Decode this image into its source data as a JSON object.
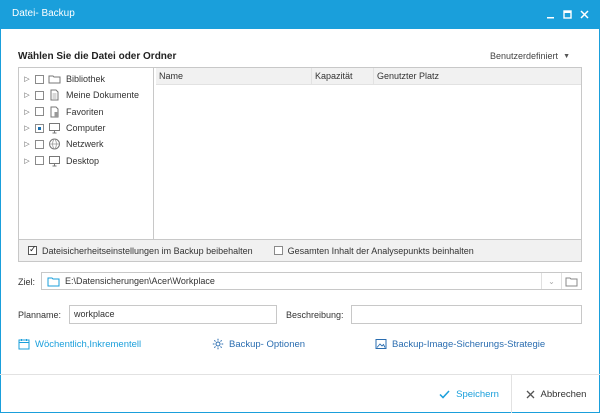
{
  "window": {
    "title": "Datei- Backup"
  },
  "section_title": "Wählen Sie die Datei oder Ordner",
  "filter_dropdown": {
    "label": "Benutzerdefiniert"
  },
  "tree": [
    {
      "label": "Bibliothek",
      "icon": "folder-icon",
      "state": "unchecked"
    },
    {
      "label": "Meine Dokumente",
      "icon": "document-icon",
      "state": "unchecked"
    },
    {
      "label": "Favoriten",
      "icon": "favorites-icon",
      "state": "unchecked"
    },
    {
      "label": "Computer",
      "icon": "computer-icon",
      "state": "partial"
    },
    {
      "label": "Netzwerk",
      "icon": "network-icon",
      "state": "unchecked"
    },
    {
      "label": "Desktop",
      "icon": "desktop-icon",
      "state": "unchecked"
    }
  ],
  "list_columns": {
    "name": "Name",
    "capacity": "Kapazität",
    "used": "Genutzter Platz"
  },
  "options": {
    "keep_security": {
      "label": "Dateisicherheitseinstellungen im Backup beibehalten",
      "checked": true
    },
    "include_analysis": {
      "label": "Gesamten Inhalt der Analysepunkts beinhalten",
      "checked": false
    }
  },
  "destination": {
    "label": "Ziel:",
    "path": "E:\\Datensicherungen\\Acer\\Workplace"
  },
  "plan_name": {
    "label": "Planname:",
    "value": "workplace"
  },
  "description": {
    "label": "Beschreibung:",
    "value": ""
  },
  "links": {
    "schedule": "Wöchentlich,Inkrementell",
    "options": "Backup- Optionen",
    "strategy": "Backup-Image-Sicherungs-Strategie"
  },
  "buttons": {
    "save": "Speichern",
    "cancel": "Abbrechen"
  },
  "colors": {
    "accent": "#1a9fdb",
    "link_active": "#1a9fdb",
    "link_default": "#2a6db0"
  }
}
